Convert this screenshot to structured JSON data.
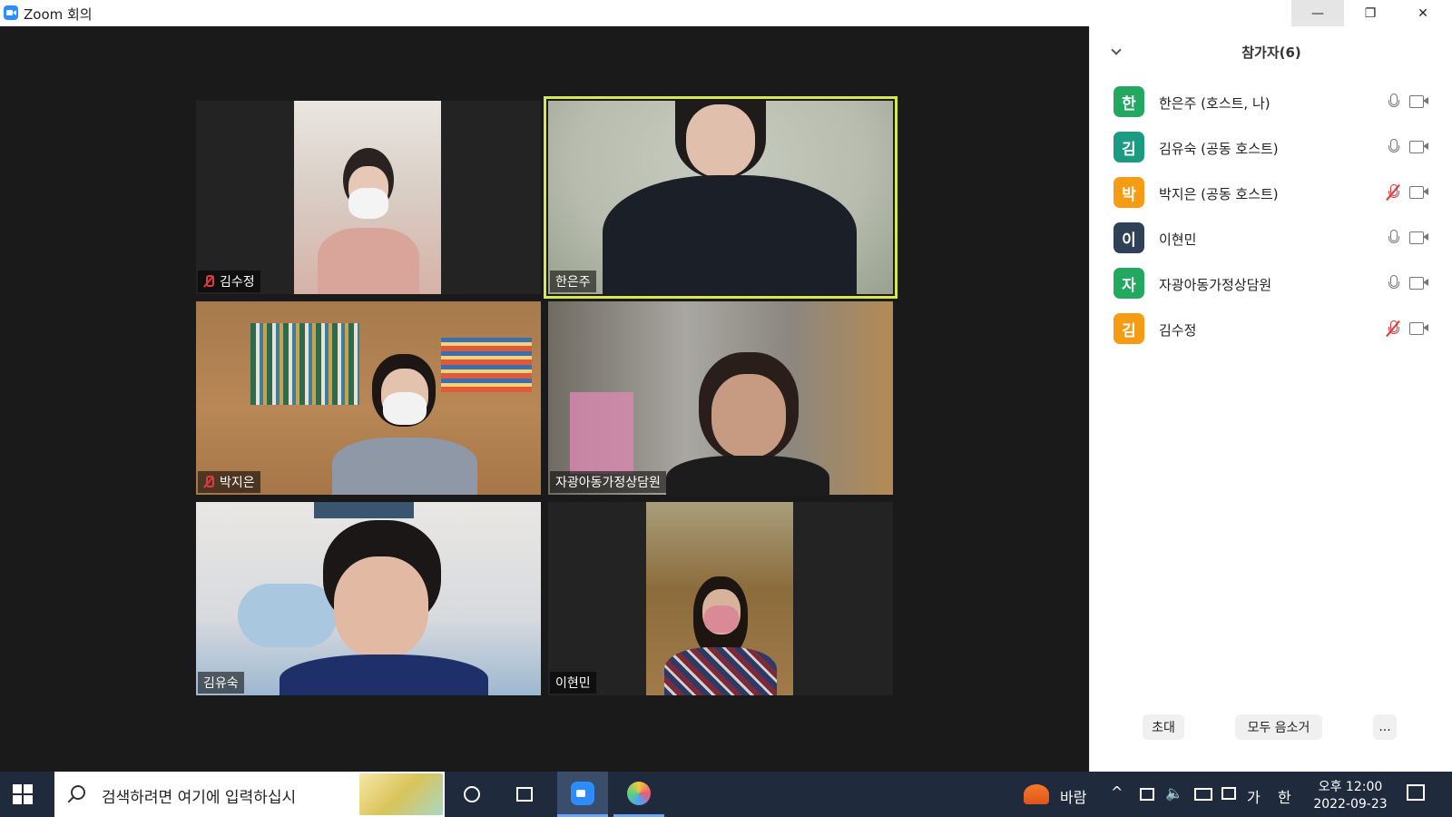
{
  "window": {
    "title": "Zoom 회의",
    "controls": {
      "minimize": "—",
      "maximize": "❐",
      "close": "✕"
    }
  },
  "video_tiles": [
    {
      "name": "김수정",
      "muted": true,
      "active": false
    },
    {
      "name": "한은주",
      "muted": false,
      "active": true
    },
    {
      "name": "박지은",
      "muted": true,
      "active": false
    },
    {
      "name": "자광아동가정상담원",
      "muted": false,
      "active": false
    },
    {
      "name": "김유숙",
      "muted": false,
      "active": false
    },
    {
      "name": "이현민",
      "muted": false,
      "active": false
    }
  ],
  "participants_panel": {
    "header": "참가자(6)",
    "participants": [
      {
        "initial": "한",
        "name": "한은주 (호스트, 나)",
        "color": "#23a860",
        "mic_muted": false
      },
      {
        "initial": "김",
        "name": "김유숙 (공동 호스트)",
        "color": "#1b9b82",
        "mic_muted": false
      },
      {
        "initial": "박",
        "name": "박지은 (공동 호스트)",
        "color": "#f59b14",
        "mic_muted": true
      },
      {
        "initial": "이",
        "name": "이현민",
        "color": "#2f4157",
        "mic_muted": false
      },
      {
        "initial": "자",
        "name": "자광아동가정상담원",
        "color": "#23a860",
        "mic_muted": false
      },
      {
        "initial": "김",
        "name": "김수정",
        "color": "#f59b14",
        "mic_muted": true
      }
    ],
    "buttons": {
      "invite": "초대",
      "mute_all": "모두 음소거",
      "more": "..."
    }
  },
  "taskbar": {
    "search_placeholder": "검색하려면 여기에 입력하십시",
    "weather": "바람",
    "ime_mode": "가",
    "ime_lang": "한",
    "time": "오후 12:00",
    "date": "2022-09-23"
  },
  "colors": {
    "active_speaker_border": "#d6e84a",
    "muted_red": "#e0393e",
    "zoom_blue": "#2d8cff"
  }
}
